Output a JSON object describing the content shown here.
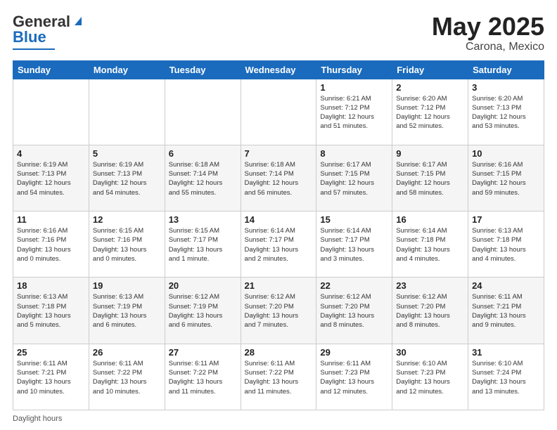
{
  "header": {
    "logo_general": "General",
    "logo_blue": "Blue",
    "title": "May 2025",
    "location": "Carona, Mexico"
  },
  "weekdays": [
    "Sunday",
    "Monday",
    "Tuesday",
    "Wednesday",
    "Thursday",
    "Friday",
    "Saturday"
  ],
  "footer_label": "Daylight hours",
  "weeks": [
    [
      {
        "num": "",
        "info": ""
      },
      {
        "num": "",
        "info": ""
      },
      {
        "num": "",
        "info": ""
      },
      {
        "num": "",
        "info": ""
      },
      {
        "num": "1",
        "info": "Sunrise: 6:21 AM\nSunset: 7:12 PM\nDaylight: 12 hours\nand 51 minutes."
      },
      {
        "num": "2",
        "info": "Sunrise: 6:20 AM\nSunset: 7:12 PM\nDaylight: 12 hours\nand 52 minutes."
      },
      {
        "num": "3",
        "info": "Sunrise: 6:20 AM\nSunset: 7:13 PM\nDaylight: 12 hours\nand 53 minutes."
      }
    ],
    [
      {
        "num": "4",
        "info": "Sunrise: 6:19 AM\nSunset: 7:13 PM\nDaylight: 12 hours\nand 54 minutes."
      },
      {
        "num": "5",
        "info": "Sunrise: 6:19 AM\nSunset: 7:13 PM\nDaylight: 12 hours\nand 54 minutes."
      },
      {
        "num": "6",
        "info": "Sunrise: 6:18 AM\nSunset: 7:14 PM\nDaylight: 12 hours\nand 55 minutes."
      },
      {
        "num": "7",
        "info": "Sunrise: 6:18 AM\nSunset: 7:14 PM\nDaylight: 12 hours\nand 56 minutes."
      },
      {
        "num": "8",
        "info": "Sunrise: 6:17 AM\nSunset: 7:15 PM\nDaylight: 12 hours\nand 57 minutes."
      },
      {
        "num": "9",
        "info": "Sunrise: 6:17 AM\nSunset: 7:15 PM\nDaylight: 12 hours\nand 58 minutes."
      },
      {
        "num": "10",
        "info": "Sunrise: 6:16 AM\nSunset: 7:15 PM\nDaylight: 12 hours\nand 59 minutes."
      }
    ],
    [
      {
        "num": "11",
        "info": "Sunrise: 6:16 AM\nSunset: 7:16 PM\nDaylight: 13 hours\nand 0 minutes."
      },
      {
        "num": "12",
        "info": "Sunrise: 6:15 AM\nSunset: 7:16 PM\nDaylight: 13 hours\nand 0 minutes."
      },
      {
        "num": "13",
        "info": "Sunrise: 6:15 AM\nSunset: 7:17 PM\nDaylight: 13 hours\nand 1 minute."
      },
      {
        "num": "14",
        "info": "Sunrise: 6:14 AM\nSunset: 7:17 PM\nDaylight: 13 hours\nand 2 minutes."
      },
      {
        "num": "15",
        "info": "Sunrise: 6:14 AM\nSunset: 7:17 PM\nDaylight: 13 hours\nand 3 minutes."
      },
      {
        "num": "16",
        "info": "Sunrise: 6:14 AM\nSunset: 7:18 PM\nDaylight: 13 hours\nand 4 minutes."
      },
      {
        "num": "17",
        "info": "Sunrise: 6:13 AM\nSunset: 7:18 PM\nDaylight: 13 hours\nand 4 minutes."
      }
    ],
    [
      {
        "num": "18",
        "info": "Sunrise: 6:13 AM\nSunset: 7:18 PM\nDaylight: 13 hours\nand 5 minutes."
      },
      {
        "num": "19",
        "info": "Sunrise: 6:13 AM\nSunset: 7:19 PM\nDaylight: 13 hours\nand 6 minutes."
      },
      {
        "num": "20",
        "info": "Sunrise: 6:12 AM\nSunset: 7:19 PM\nDaylight: 13 hours\nand 6 minutes."
      },
      {
        "num": "21",
        "info": "Sunrise: 6:12 AM\nSunset: 7:20 PM\nDaylight: 13 hours\nand 7 minutes."
      },
      {
        "num": "22",
        "info": "Sunrise: 6:12 AM\nSunset: 7:20 PM\nDaylight: 13 hours\nand 8 minutes."
      },
      {
        "num": "23",
        "info": "Sunrise: 6:12 AM\nSunset: 7:20 PM\nDaylight: 13 hours\nand 8 minutes."
      },
      {
        "num": "24",
        "info": "Sunrise: 6:11 AM\nSunset: 7:21 PM\nDaylight: 13 hours\nand 9 minutes."
      }
    ],
    [
      {
        "num": "25",
        "info": "Sunrise: 6:11 AM\nSunset: 7:21 PM\nDaylight: 13 hours\nand 10 minutes."
      },
      {
        "num": "26",
        "info": "Sunrise: 6:11 AM\nSunset: 7:22 PM\nDaylight: 13 hours\nand 10 minutes."
      },
      {
        "num": "27",
        "info": "Sunrise: 6:11 AM\nSunset: 7:22 PM\nDaylight: 13 hours\nand 11 minutes."
      },
      {
        "num": "28",
        "info": "Sunrise: 6:11 AM\nSunset: 7:22 PM\nDaylight: 13 hours\nand 11 minutes."
      },
      {
        "num": "29",
        "info": "Sunrise: 6:11 AM\nSunset: 7:23 PM\nDaylight: 13 hours\nand 12 minutes."
      },
      {
        "num": "30",
        "info": "Sunrise: 6:10 AM\nSunset: 7:23 PM\nDaylight: 13 hours\nand 12 minutes."
      },
      {
        "num": "31",
        "info": "Sunrise: 6:10 AM\nSunset: 7:24 PM\nDaylight: 13 hours\nand 13 minutes."
      }
    ]
  ]
}
